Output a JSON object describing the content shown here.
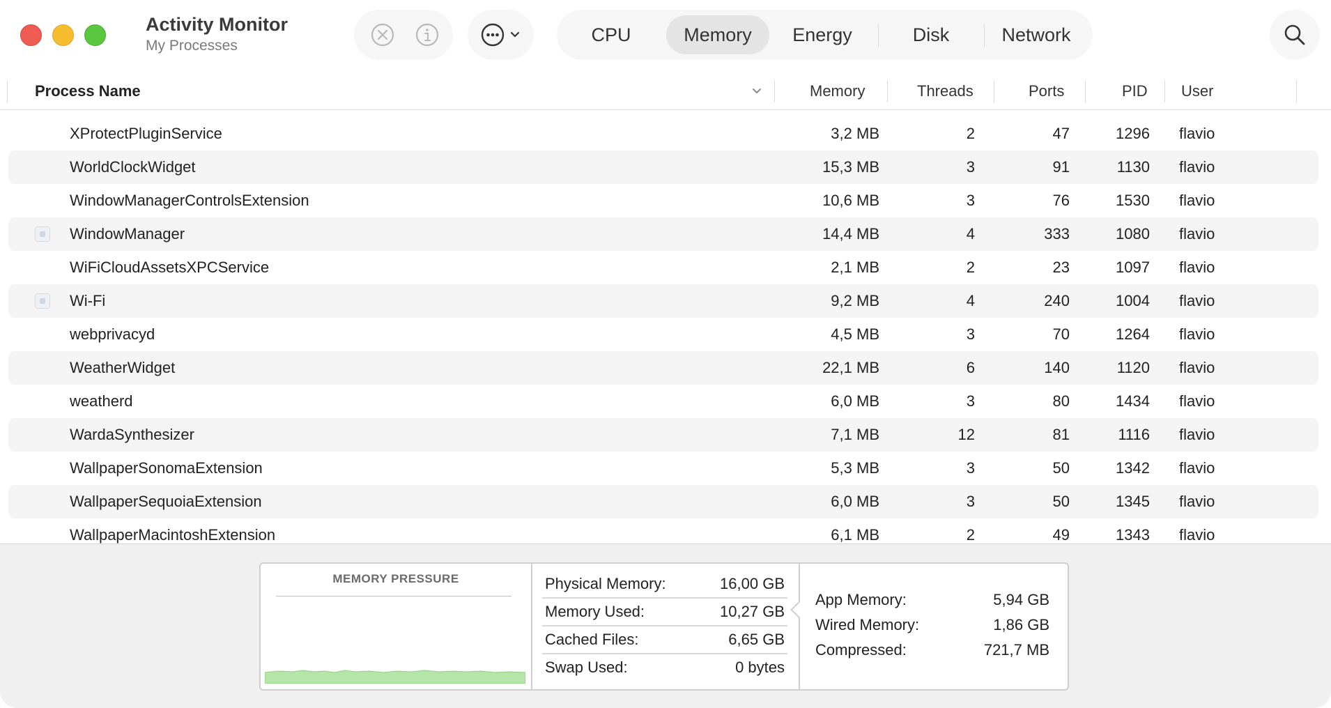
{
  "app": {
    "title": "Activity Monitor",
    "subtitle": "My Processes"
  },
  "toolbar": {
    "stop_icon": "stop-process-icon",
    "info_icon": "info-icon",
    "more_icon": "ellipsis-circle-icon",
    "search_icon": "search-icon",
    "tabs": [
      {
        "label": "CPU",
        "active": false
      },
      {
        "label": "Memory",
        "active": true
      },
      {
        "label": "Energy",
        "active": false
      },
      {
        "label": "Disk",
        "active": false
      },
      {
        "label": "Network",
        "active": false
      }
    ]
  },
  "table": {
    "columns": {
      "name": "Process Name",
      "memory": "Memory",
      "threads": "Threads",
      "ports": "Ports",
      "pid": "PID",
      "user": "User"
    },
    "rows": [
      {
        "name": "XProtectPluginService",
        "memory": "3,2 MB",
        "threads": "2",
        "ports": "47",
        "pid": "1296",
        "user": "flavio",
        "icon": false
      },
      {
        "name": "WorldClockWidget",
        "memory": "15,3 MB",
        "threads": "3",
        "ports": "91",
        "pid": "1130",
        "user": "flavio",
        "icon": false
      },
      {
        "name": "WindowManagerControlsExtension",
        "memory": "10,6 MB",
        "threads": "3",
        "ports": "76",
        "pid": "1530",
        "user": "flavio",
        "icon": false
      },
      {
        "name": "WindowManager",
        "memory": "14,4 MB",
        "threads": "4",
        "ports": "333",
        "pid": "1080",
        "user": "flavio",
        "icon": true
      },
      {
        "name": "WiFiCloudAssetsXPCService",
        "memory": "2,1 MB",
        "threads": "2",
        "ports": "23",
        "pid": "1097",
        "user": "flavio",
        "icon": false
      },
      {
        "name": "Wi-Fi",
        "memory": "9,2 MB",
        "threads": "4",
        "ports": "240",
        "pid": "1004",
        "user": "flavio",
        "icon": true
      },
      {
        "name": "webprivacyd",
        "memory": "4,5 MB",
        "threads": "3",
        "ports": "70",
        "pid": "1264",
        "user": "flavio",
        "icon": false
      },
      {
        "name": "WeatherWidget",
        "memory": "22,1 MB",
        "threads": "6",
        "ports": "140",
        "pid": "1120",
        "user": "flavio",
        "icon": false
      },
      {
        "name": "weatherd",
        "memory": "6,0 MB",
        "threads": "3",
        "ports": "80",
        "pid": "1434",
        "user": "flavio",
        "icon": false
      },
      {
        "name": "WardaSynthesizer",
        "memory": "7,1 MB",
        "threads": "12",
        "ports": "81",
        "pid": "1116",
        "user": "flavio",
        "icon": false
      },
      {
        "name": "WallpaperSonomaExtension",
        "memory": "5,3 MB",
        "threads": "3",
        "ports": "50",
        "pid": "1342",
        "user": "flavio",
        "icon": false
      },
      {
        "name": "WallpaperSequoiaExtension",
        "memory": "6,0 MB",
        "threads": "3",
        "ports": "50",
        "pid": "1345",
        "user": "flavio",
        "icon": false
      },
      {
        "name": "WallpaperMacintoshExtension",
        "memory": "6,1 MB",
        "threads": "2",
        "ports": "49",
        "pid": "1343",
        "user": "flavio",
        "icon": false
      }
    ]
  },
  "stats": {
    "pressure_title": "MEMORY PRESSURE",
    "pressure_color": "#b5e5a8",
    "memory": [
      {
        "label": "Physical Memory:",
        "value": "16,00 GB"
      },
      {
        "label": "Memory Used:",
        "value": "10,27 GB"
      },
      {
        "label": "Cached Files:",
        "value": "6,65 GB"
      },
      {
        "label": "Swap Used:",
        "value": "0 bytes"
      }
    ],
    "breakdown": [
      {
        "label": "App Memory:",
        "value": "5,94 GB"
      },
      {
        "label": "Wired Memory:",
        "value": "1,86 GB"
      },
      {
        "label": "Compressed:",
        "value": "721,7 MB"
      }
    ]
  }
}
